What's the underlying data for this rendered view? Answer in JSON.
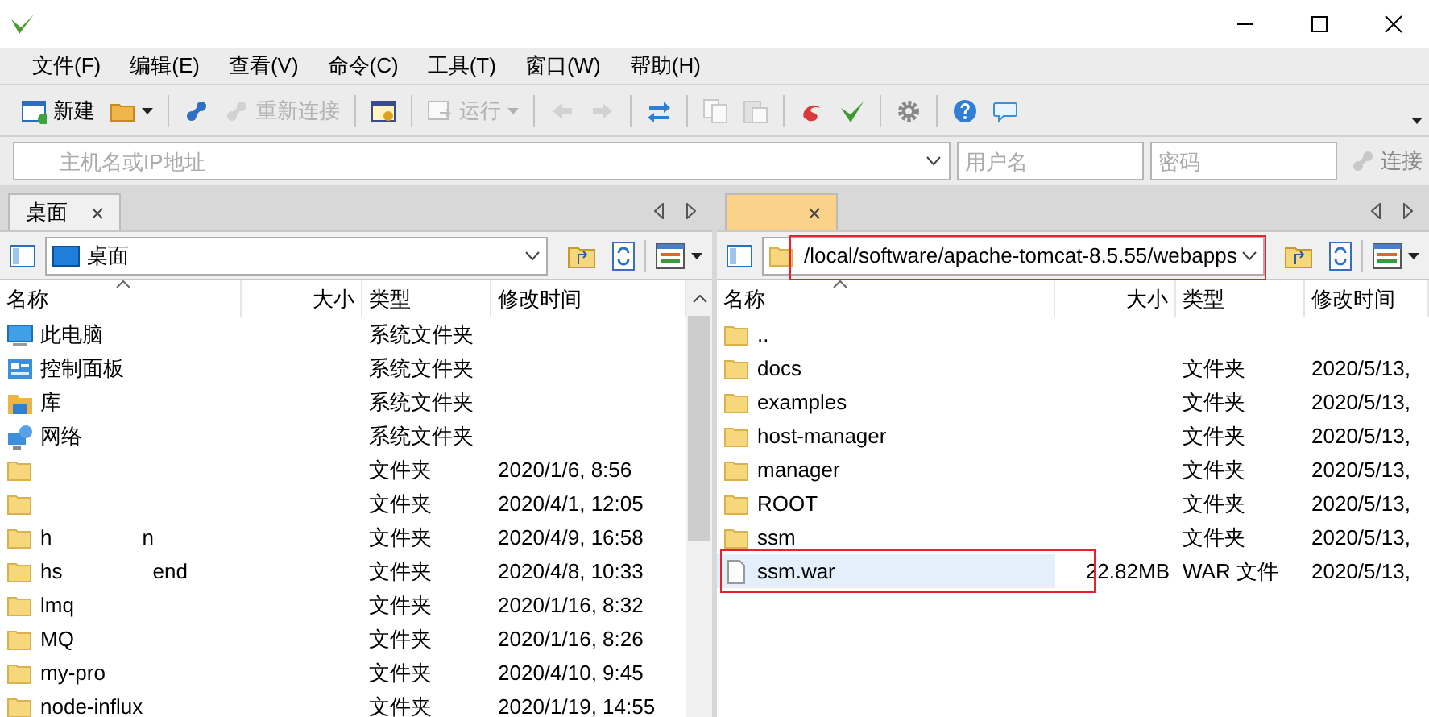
{
  "menu": [
    "文件(F)",
    "编辑(E)",
    "查看(V)",
    "命令(C)",
    "工具(T)",
    "窗口(W)",
    "帮助(H)"
  ],
  "toolbar": [
    {
      "kind": "button",
      "label": "新建",
      "disabled": false
    },
    {
      "kind": "dropdown",
      "disabled": false
    },
    {
      "kind": "sep"
    },
    {
      "kind": "button",
      "disabled": false
    },
    {
      "kind": "button",
      "label": "重新连接",
      "disabled": true
    },
    {
      "kind": "sep"
    },
    {
      "kind": "button",
      "disabled": false
    },
    {
      "kind": "sep"
    },
    {
      "kind": "dropdown",
      "label": "运行",
      "disabled": true
    },
    {
      "kind": "sep"
    },
    {
      "kind": "button",
      "disabled": true
    },
    {
      "kind": "button",
      "disabled": true
    },
    {
      "kind": "sep"
    },
    {
      "kind": "button",
      "disabled": false
    },
    {
      "kind": "sep"
    },
    {
      "kind": "button",
      "disabled": true
    },
    {
      "kind": "button",
      "disabled": true
    },
    {
      "kind": "sep"
    },
    {
      "kind": "button",
      "disabled": false
    },
    {
      "kind": "button",
      "disabled": false
    },
    {
      "kind": "sep"
    },
    {
      "kind": "button",
      "disabled": false
    },
    {
      "kind": "sep"
    },
    {
      "kind": "button",
      "disabled": false
    },
    {
      "kind": "button",
      "disabled": false
    }
  ],
  "address_bar": {
    "host_placeholder": "主机名或IP地址",
    "user_placeholder": "用户名",
    "password_placeholder": "密码",
    "connect": "连接"
  },
  "panes": [
    {
      "kind": "local",
      "tab": {
        "label": "桌面",
        "selected": false
      },
      "path": "桌面",
      "highlighted": false,
      "columns": [
        "名称",
        "大小",
        "类型",
        "修改时间"
      ],
      "rows": [
        {
          "kind": "system",
          "name_parts": [
            "此电脑"
          ],
          "type": "系统文件夹",
          "selected": false,
          "highlighted": false
        },
        {
          "kind": "system",
          "name_parts": [
            "控制面板"
          ],
          "type": "系统文件夹",
          "selected": false,
          "highlighted": false
        },
        {
          "kind": "system",
          "name_parts": [
            "库"
          ],
          "type": "系统文件夹",
          "selected": false,
          "highlighted": false
        },
        {
          "kind": "system",
          "name_parts": [
            "网络"
          ],
          "type": "系统文件夹",
          "selected": false,
          "highlighted": false
        },
        {
          "kind": "folder",
          "name_parts": [],
          "type": "文件夹",
          "date": "2020/1/6, 8:56",
          "selected": false,
          "highlighted": false
        },
        {
          "kind": "folder",
          "name_parts": [],
          "type": "文件夹",
          "date": "2020/4/1, 12:05",
          "selected": false,
          "highlighted": false
        },
        {
          "kind": "folder",
          "name_parts": [
            "h",
            "n"
          ],
          "type": "文件夹",
          "date": "2020/4/9, 16:58",
          "selected": false,
          "highlighted": false
        },
        {
          "kind": "folder",
          "name_parts": [
            "hs",
            "end"
          ],
          "type": "文件夹",
          "date": "2020/4/8, 10:33",
          "selected": false,
          "highlighted": false
        },
        {
          "kind": "folder",
          "name_parts": [
            "lmq"
          ],
          "type": "文件夹",
          "date": "2020/1/16, 8:32",
          "selected": false,
          "highlighted": false
        },
        {
          "kind": "folder",
          "name_parts": [
            "MQ"
          ],
          "type": "文件夹",
          "date": "2020/1/16, 8:26",
          "selected": false,
          "highlighted": false
        },
        {
          "kind": "folder",
          "name_parts": [
            "my-pro"
          ],
          "type": "文件夹",
          "date": "2020/4/10, 9:45",
          "selected": false,
          "highlighted": false
        },
        {
          "kind": "folder",
          "name_parts": [
            "node-influx"
          ],
          "type": "文件夹",
          "date": "2020/1/19, 14:55",
          "selected": false,
          "highlighted": false
        }
      ]
    },
    {
      "kind": "remote",
      "tab": {
        "selected": true
      },
      "path": "/local/software/apache-tomcat-8.5.55/webapps",
      "highlighted": true,
      "columns": [
        "名称",
        "大小",
        "类型",
        "修改时间"
      ],
      "rows": [
        {
          "kind": "folder",
          "name_parts": [
            ".."
          ],
          "selected": false,
          "highlighted": false
        },
        {
          "kind": "folder",
          "name_parts": [
            "docs"
          ],
          "type": "文件夹",
          "date": "2020/5/13,",
          "selected": false,
          "highlighted": false
        },
        {
          "kind": "folder",
          "name_parts": [
            "examples"
          ],
          "type": "文件夹",
          "date": "2020/5/13,",
          "selected": false,
          "highlighted": false
        },
        {
          "kind": "folder",
          "name_parts": [
            "host-manager"
          ],
          "type": "文件夹",
          "date": "2020/5/13,",
          "selected": false,
          "highlighted": false
        },
        {
          "kind": "folder",
          "name_parts": [
            "manager"
          ],
          "type": "文件夹",
          "date": "2020/5/13,",
          "selected": false,
          "highlighted": false
        },
        {
          "kind": "folder",
          "name_parts": [
            "ROOT"
          ],
          "type": "文件夹",
          "date": "2020/5/13,",
          "selected": false,
          "highlighted": false
        },
        {
          "kind": "folder",
          "name_parts": [
            "ssm"
          ],
          "type": "文件夹",
          "date": "2020/5/13,",
          "selected": false,
          "highlighted": false
        },
        {
          "kind": "file",
          "name_parts": [
            "ssm.war"
          ],
          "size": "22.82MB",
          "type": "WAR 文件",
          "date": "2020/5/13,",
          "selected": true,
          "highlighted": true
        }
      ]
    }
  ]
}
